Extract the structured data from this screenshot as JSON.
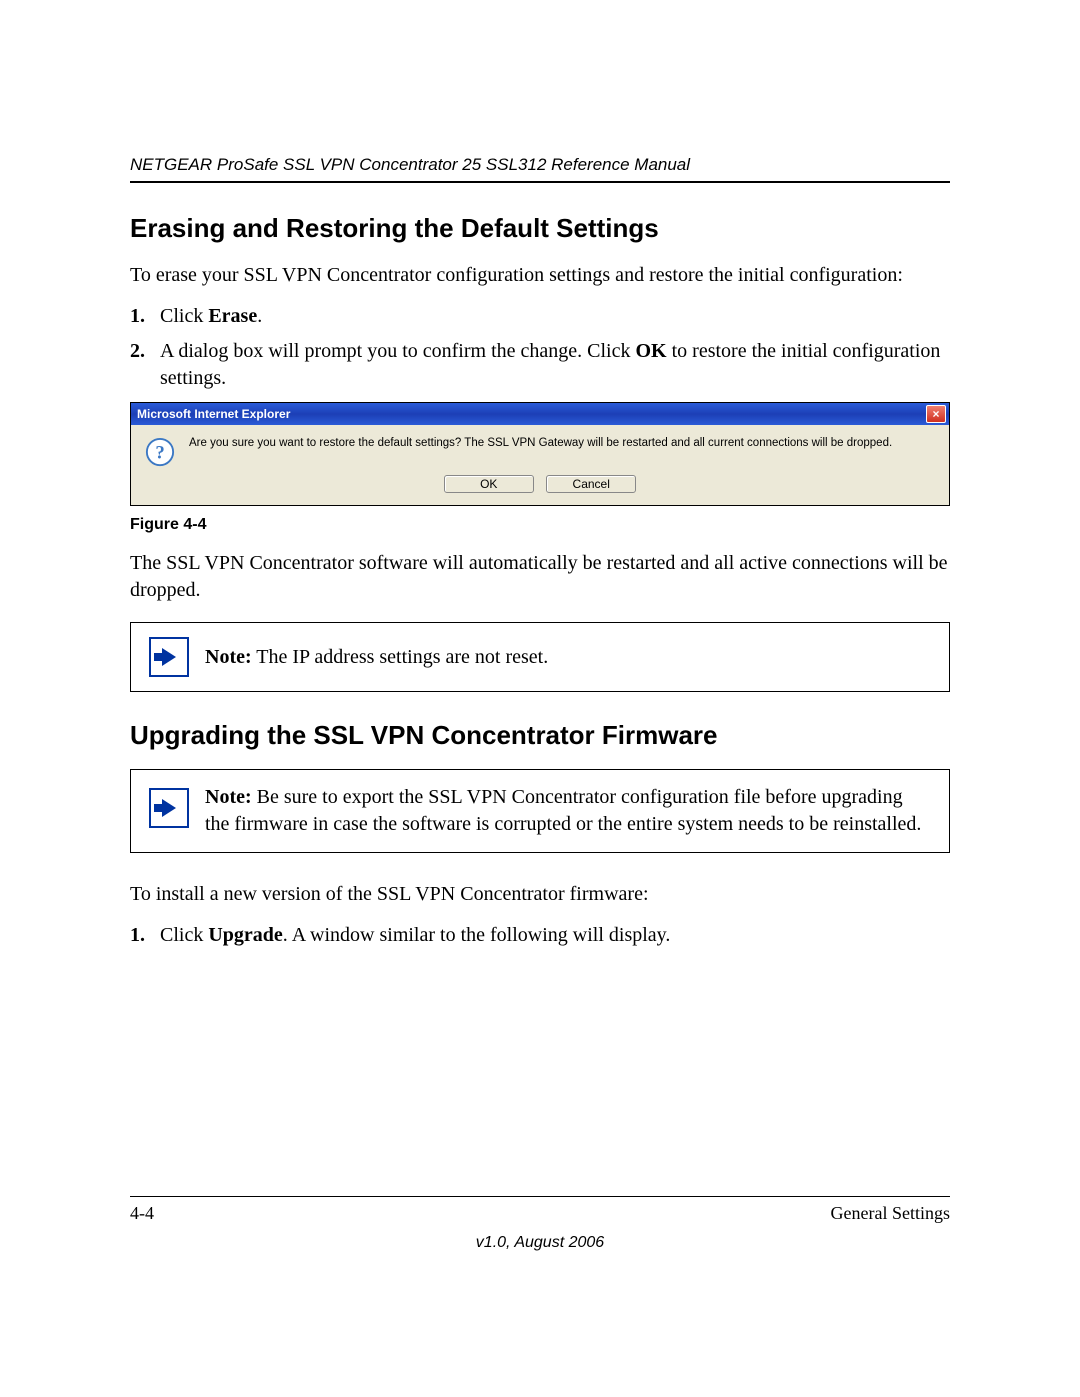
{
  "header": {
    "running_title": "NETGEAR ProSafe SSL VPN Concentrator 25 SSL312 Reference Manual"
  },
  "section1": {
    "heading": "Erasing and Restoring the Default Settings",
    "intro": "To erase your SSL VPN Concentrator configuration settings and restore the initial configuration:",
    "step1_num": "1.",
    "step1_a": "Click ",
    "step1_b": "Erase",
    "step1_c": ".",
    "step2_num": "2.",
    "step2_a": "A dialog box will prompt you to confirm the change. Click ",
    "step2_b": "OK",
    "step2_c": " to restore the initial configuration settings.",
    "after_fig": "The SSL VPN Concentrator software will automatically be restarted and all active connections will be dropped.",
    "note_label": "Note:",
    "note_text": " The IP address settings are not reset."
  },
  "dialog": {
    "title": "Microsoft Internet Explorer",
    "message": "Are you sure you want to restore the default settings? The SSL VPN Gateway will be restarted and all current connections will be dropped.",
    "ok": "OK",
    "cancel": "Cancel",
    "close": "×"
  },
  "figure": {
    "caption": "Figure 4-4"
  },
  "section2": {
    "heading": "Upgrading the SSL VPN Concentrator Firmware",
    "note_label": "Note:",
    "note_text": " Be sure to export the SSL VPN Concentrator configuration file before upgrading the firmware in case the software is corrupted or the entire system needs to be reinstalled.",
    "intro": "To install a new version of the SSL VPN Concentrator firmware:",
    "step1_num": "1.",
    "step1_a": "Click ",
    "step1_b": "Upgrade",
    "step1_c": ". A window similar to the following will display."
  },
  "footer": {
    "page": "4-4",
    "section": "General Settings",
    "version": "v1.0, August 2006"
  }
}
